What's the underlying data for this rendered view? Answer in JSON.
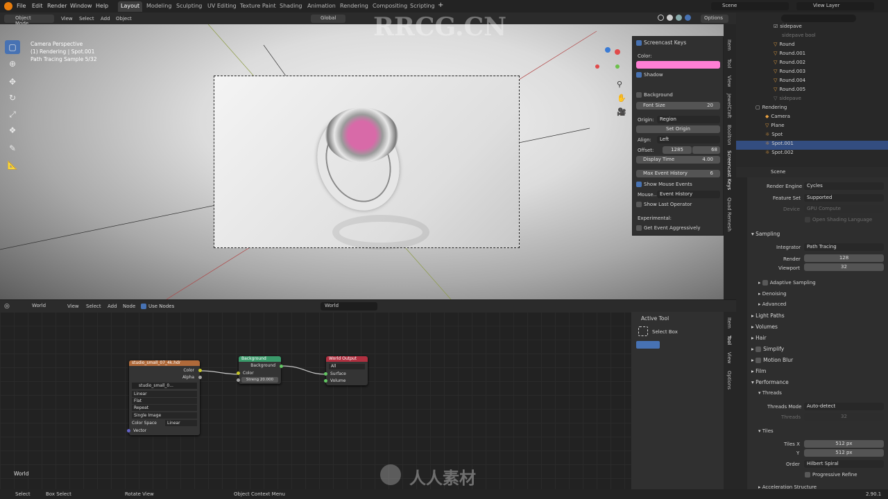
{
  "topbar": {
    "menus": [
      "File",
      "Edit",
      "Render",
      "Window",
      "Help"
    ],
    "workspaces": [
      "Layout",
      "Modeling",
      "Sculpting",
      "UV Editing",
      "Texture Paint",
      "Shading",
      "Animation",
      "Rendering",
      "Compositing",
      "Scripting"
    ],
    "active_workspace": "Layout",
    "scene": "Scene",
    "view_layer": "View Layer"
  },
  "viewport_header": {
    "mode": "Object Mode",
    "menus": [
      "View",
      "Select",
      "Add",
      "Object"
    ],
    "transform": "Global",
    "options": "Options"
  },
  "viewport_info": {
    "line1": "Camera Perspective",
    "line2": "(1) Rendering | Spot.001",
    "line3": "Path Tracing Sample 5/32"
  },
  "screencast": {
    "title": "Screencast Keys",
    "color_label": "Color:",
    "color": "#ff7fd4",
    "shadow": "Shadow",
    "background": "Background",
    "font_size_label": "Font Size",
    "font_size": "20",
    "origin_label": "Origin:",
    "origin": "Region",
    "set_origin": "Set Origin",
    "align_label": "Align:",
    "align": "Left",
    "offset_label": "Offset:",
    "offset_x": "1285",
    "offset_y": "68",
    "display_time_label": "Display Time",
    "display_time": "4.00",
    "max_event_label": "Max Event History",
    "max_event": "6",
    "show_mouse": "Show Mouse Events",
    "mouse_label": "Mouse...",
    "mouse_value": "Event History",
    "show_last": "Show Last Operator",
    "experimental": "Experimental:",
    "get_event": "Get Event Aggressively"
  },
  "viewport_tabs": [
    "Item",
    "Tool",
    "View",
    "JewelCraft",
    "Booltron",
    "Screencast Keys",
    "Quad Remesh"
  ],
  "node_header": {
    "world_type": "World",
    "menus": [
      "View",
      "Select",
      "Add",
      "Node"
    ],
    "use_nodes": "Use Nodes",
    "world_name": "World"
  },
  "nodes": {
    "env_title": "studio_small_07_4k.hdr",
    "env_out_color": "Color",
    "env_out_alpha": "Alpha",
    "env_image": "studio_small_0...",
    "env_interp": "Linear",
    "env_proj": "Flat",
    "env_ext": "Repeat",
    "env_source": "Single Image",
    "env_cs_label": "Color Space",
    "env_cs": "Linear",
    "env_vector": "Vector",
    "bg_title": "Background",
    "bg_out": "Background",
    "bg_color": "Color",
    "bg_strength": "Streng 20.000",
    "wo_title": "World Output",
    "wo_target": "All",
    "wo_surface": "Surface",
    "wo_volume": "Volume",
    "editor_label": "World"
  },
  "active_tool": {
    "title": "Active Tool",
    "tool": "Select Box",
    "tabs": [
      "Item",
      "Tool",
      "View",
      "Options"
    ]
  },
  "outliner": {
    "search_placeholder": "",
    "rows": [
      {
        "name": "sidepave",
        "dim": false
      },
      {
        "name": "sidepave bool",
        "dim": true
      },
      {
        "name": "Round",
        "dim": false
      },
      {
        "name": "Round.001",
        "dim": false
      },
      {
        "name": "Round.002",
        "dim": false
      },
      {
        "name": "Round.003",
        "dim": false
      },
      {
        "name": "Round.004",
        "dim": false
      },
      {
        "name": "Round.005",
        "dim": false
      },
      {
        "name": "sidepave",
        "dim": true
      },
      {
        "name": "Rendering",
        "dim": false
      },
      {
        "name": "Camera",
        "dim": false
      },
      {
        "name": "Plane",
        "dim": false
      },
      {
        "name": "Spot",
        "dim": false
      },
      {
        "name": "Spot.001",
        "dim": false
      },
      {
        "name": "Spot.002",
        "dim": false
      }
    ]
  },
  "properties": {
    "context": "Scene",
    "render_engine_label": "Render Engine",
    "render_engine": "Cycles",
    "feature_set_label": "Feature Set",
    "feature_set": "Supported",
    "device_label": "Device",
    "device": "GPU Compute",
    "osl": "Open Shading Language",
    "sampling": "Sampling",
    "integrator_label": "Integrator",
    "integrator": "Path Tracing",
    "render_label": "Render",
    "render": "128",
    "viewport_label": "Viewport",
    "viewport": "32",
    "adaptive": "Adaptive Sampling",
    "denoising": "Denoising",
    "advanced": "Advanced",
    "light_paths": "Light Paths",
    "volumes": "Volumes",
    "hair": "Hair",
    "simplify": "Simplify",
    "motion_blur": "Motion Blur",
    "film": "Film",
    "performance": "Performance",
    "threads": "Threads",
    "threads_mode_label": "Threads Mode",
    "threads_mode": "Auto-detect",
    "threads_count_label": "Threads",
    "threads_count": "32",
    "tiles": "Tiles",
    "tiles_x_label": "Tiles X",
    "tiles_x": "512 px",
    "tiles_y_label": "Y",
    "tiles_y": "512 px",
    "order_label": "Order",
    "order": "Hilbert Spiral",
    "progressive": "Progressive Refine",
    "accel": "Acceleration Structure"
  },
  "statusbar": {
    "select": "Select",
    "box_select": "Box Select",
    "rotate": "Rotate View",
    "context_menu": "Object Context Menu",
    "version": "2.90.1"
  },
  "watermark": {
    "main": "RRCG.CN",
    "bottom": "人人素材"
  }
}
